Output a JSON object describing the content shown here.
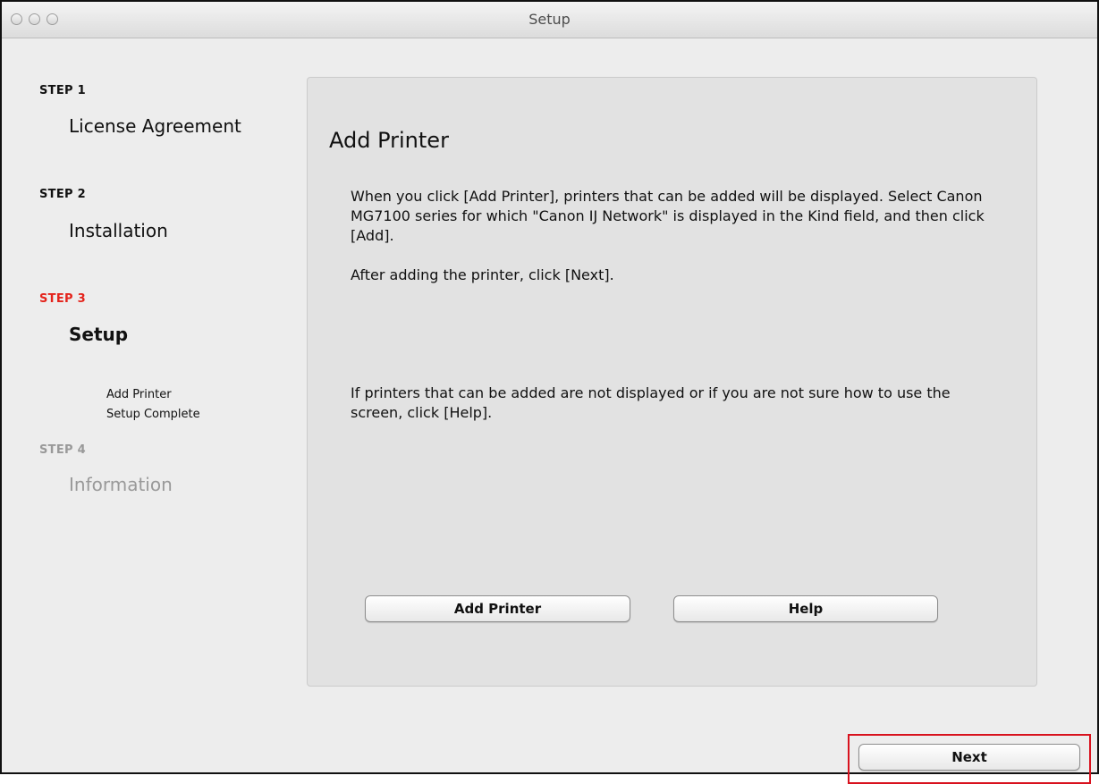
{
  "window": {
    "title": "Setup"
  },
  "sidebar": {
    "steps": [
      {
        "label": "STEP 1",
        "title": "License Agreement"
      },
      {
        "label": "STEP 2",
        "title": "Installation"
      },
      {
        "label": "STEP 3",
        "title": "Setup",
        "substeps": [
          "Add Printer",
          "Setup Complete"
        ]
      },
      {
        "label": "STEP 4",
        "title": "Information"
      }
    ]
  },
  "panel": {
    "title": "Add Printer",
    "paragraph1": "When you click [Add Printer], printers that can be added will be displayed. Select Canon MG7100 series for which \"Canon IJ Network\" is displayed in the Kind field, and then click [Add].",
    "paragraph1b": "After adding the printer, click [Next].",
    "paragraph2": "If printers that can be added are not displayed or if you are not sure how to use the screen, click [Help].",
    "add_printer_label": "Add Printer",
    "help_label": "Help"
  },
  "footer": {
    "next_label": "Next"
  },
  "colors": {
    "current_step": "#e4231b",
    "disabled_step": "#999999",
    "highlight": "#d8121e"
  }
}
